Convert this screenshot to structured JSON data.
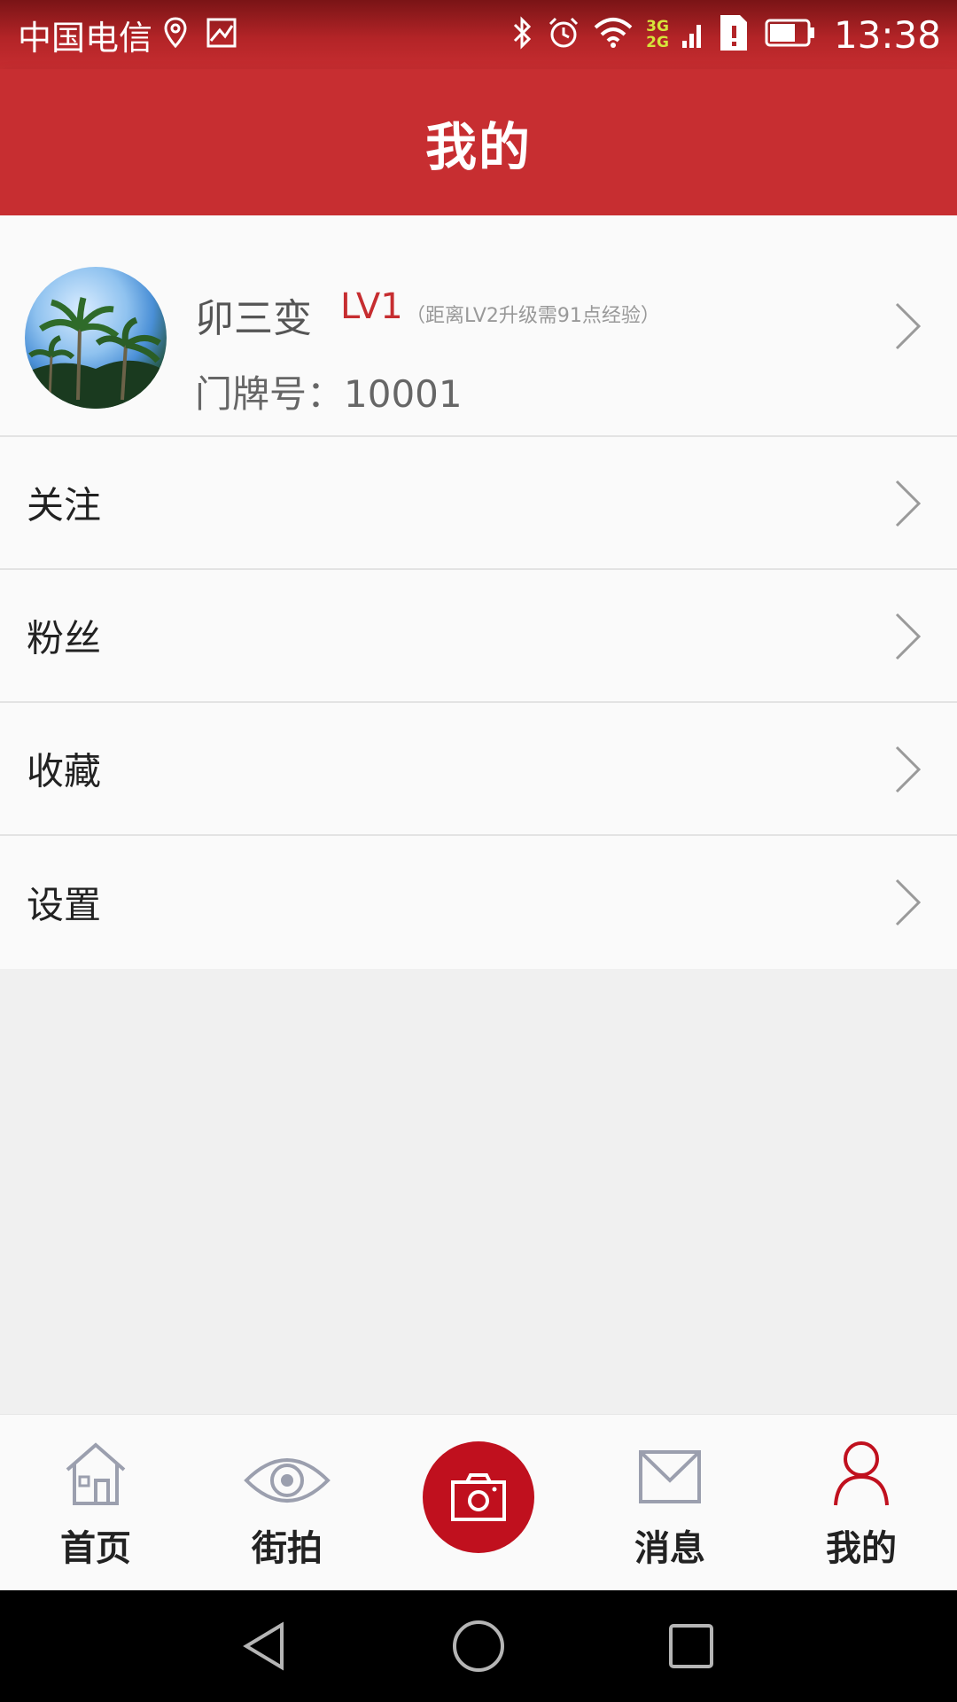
{
  "status_bar": {
    "carrier": "中国电信",
    "network_top": "3G",
    "network_bottom": "2G",
    "time": "13:38",
    "icons": [
      "location-icon",
      "image-icon",
      "bluetooth-icon",
      "alarm-icon",
      "wifi-icon",
      "signal-icon",
      "sim-alert-icon",
      "battery-icon"
    ]
  },
  "header": {
    "title": "我的"
  },
  "profile": {
    "username": "卯三变",
    "level": "LV1",
    "level_hint": "（距离LV2升级需91点经验）",
    "doorplate": "门牌号：10001"
  },
  "menu": {
    "items": [
      {
        "label": "关注"
      },
      {
        "label": "粉丝"
      },
      {
        "label": "收藏"
      },
      {
        "label": "设置"
      }
    ]
  },
  "bottom_nav": {
    "items": [
      {
        "label": "首页",
        "icon": "home-icon"
      },
      {
        "label": "街拍",
        "icon": "eye-icon"
      },
      {
        "label": "",
        "icon": "camera-icon"
      },
      {
        "label": "消息",
        "icon": "mail-icon"
      },
      {
        "label": "我的",
        "icon": "user-icon"
      }
    ],
    "active_index": 4
  },
  "colors": {
    "brand_red": "#c72e31",
    "camera_red": "#c0101e",
    "inactive_icon": "#9b9fae"
  }
}
